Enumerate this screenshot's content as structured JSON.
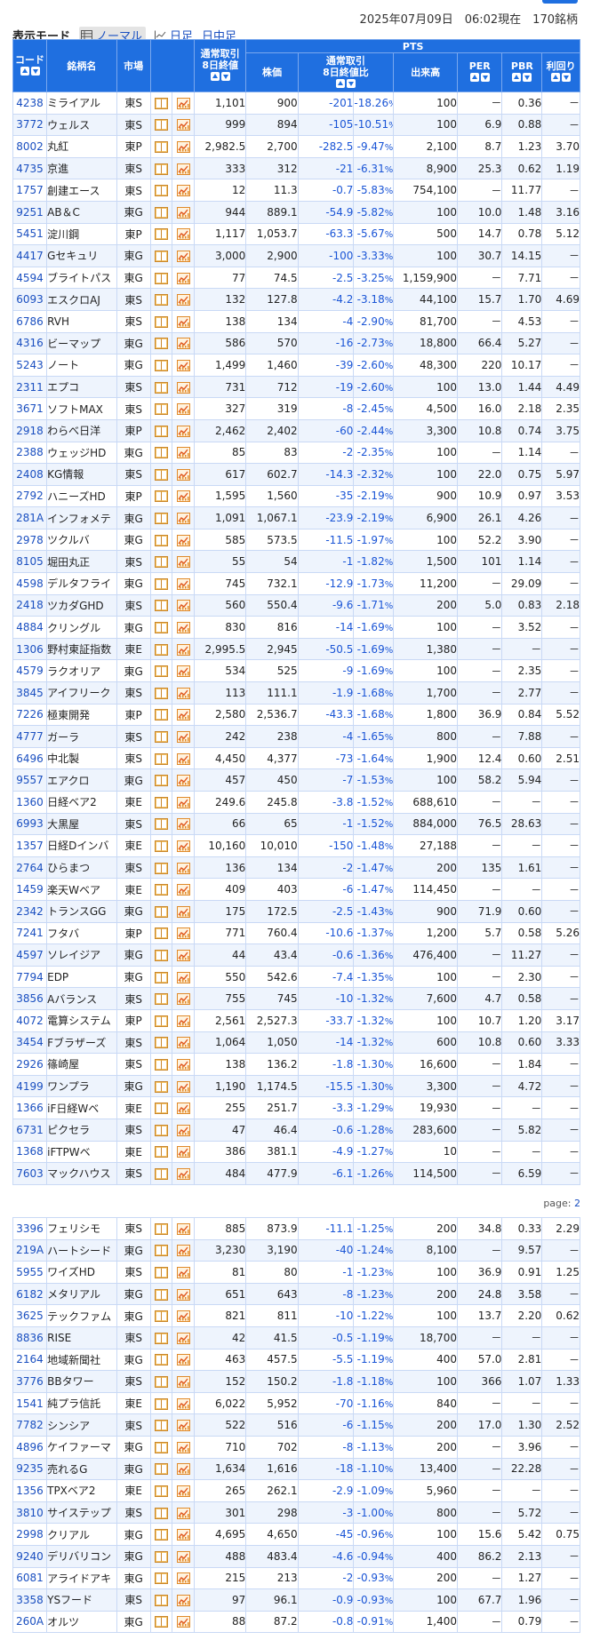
{
  "header": {
    "datetime": "2025年07月09日　06:02現在　170銘柄",
    "mode_label": "表示モード",
    "modes": [
      "ノーマル",
      "日足",
      "日中足"
    ]
  },
  "columns": {
    "code": "コード",
    "name": "銘柄名",
    "market": "市場",
    "prev_close": "通常取引\n8日終値",
    "pts_group": "PTS",
    "price": "株価",
    "change": "通常取引\n8日終値比",
    "volume": "出来高",
    "per": "PER",
    "pbr": "PBR",
    "yield": "利回り"
  },
  "pager": {
    "label": "page: ",
    "link": "2"
  },
  "rows1": [
    [
      "4238",
      "ミライアル",
      "東S",
      "1,101",
      "900",
      "-201",
      "-18.26",
      "100",
      "－",
      "0.36",
      "－"
    ],
    [
      "3772",
      "ウェルス",
      "東S",
      "999",
      "894",
      "-105",
      "-10.51",
      "100",
      "6.9",
      "0.88",
      "－"
    ],
    [
      "8002",
      "丸紅",
      "東P",
      "2,982.5",
      "2,700",
      "-282.5",
      "-9.47",
      "2,100",
      "8.7",
      "1.23",
      "3.70"
    ],
    [
      "4735",
      "京進",
      "東S",
      "333",
      "312",
      "-21",
      "-6.31",
      "8,900",
      "25.3",
      "0.62",
      "1.19"
    ],
    [
      "1757",
      "創建エース",
      "東S",
      "12",
      "11.3",
      "-0.7",
      "-5.83",
      "754,100",
      "－",
      "11.77",
      "－"
    ],
    [
      "9251",
      "AB＆C",
      "東G",
      "944",
      "889.1",
      "-54.9",
      "-5.82",
      "100",
      "10.0",
      "1.48",
      "3.16"
    ],
    [
      "5451",
      "淀川鋼",
      "東P",
      "1,117",
      "1,053.7",
      "-63.3",
      "-5.67",
      "500",
      "14.7",
      "0.78",
      "5.12"
    ],
    [
      "4417",
      "Gセキュリ",
      "東G",
      "3,000",
      "2,900",
      "-100",
      "-3.33",
      "100",
      "30.7",
      "14.15",
      "－"
    ],
    [
      "4594",
      "ブライトパス",
      "東G",
      "77",
      "74.5",
      "-2.5",
      "-3.25",
      "1,159,900",
      "－",
      "7.71",
      "－"
    ],
    [
      "6093",
      "エスクロAJ",
      "東S",
      "132",
      "127.8",
      "-4.2",
      "-3.18",
      "44,100",
      "15.7",
      "1.70",
      "4.69"
    ],
    [
      "6786",
      "RVH",
      "東S",
      "138",
      "134",
      "-4",
      "-2.90",
      "81,700",
      "－",
      "4.53",
      "－"
    ],
    [
      "4316",
      "ビーマップ",
      "東G",
      "586",
      "570",
      "-16",
      "-2.73",
      "18,800",
      "66.4",
      "5.27",
      "－"
    ],
    [
      "5243",
      "ノート",
      "東G",
      "1,499",
      "1,460",
      "-39",
      "-2.60",
      "48,300",
      "220",
      "10.17",
      "－"
    ],
    [
      "2311",
      "エプコ",
      "東S",
      "731",
      "712",
      "-19",
      "-2.60",
      "100",
      "13.0",
      "1.44",
      "4.49"
    ],
    [
      "3671",
      "ソフトMAX",
      "東S",
      "327",
      "319",
      "-8",
      "-2.45",
      "4,500",
      "16.0",
      "2.18",
      "2.35"
    ],
    [
      "2918",
      "わらべ日洋",
      "東P",
      "2,462",
      "2,402",
      "-60",
      "-2.44",
      "3,300",
      "10.8",
      "0.74",
      "3.75"
    ],
    [
      "2388",
      "ウェッジHD",
      "東G",
      "85",
      "83",
      "-2",
      "-2.35",
      "100",
      "－",
      "1.14",
      "－"
    ],
    [
      "2408",
      "KG情報",
      "東S",
      "617",
      "602.7",
      "-14.3",
      "-2.32",
      "100",
      "22.0",
      "0.75",
      "5.97"
    ],
    [
      "2792",
      "ハニーズHD",
      "東P",
      "1,595",
      "1,560",
      "-35",
      "-2.19",
      "900",
      "10.9",
      "0.97",
      "3.53"
    ],
    [
      "281A",
      "インフォメテ",
      "東G",
      "1,091",
      "1,067.1",
      "-23.9",
      "-2.19",
      "6,900",
      "26.1",
      "4.26",
      "－"
    ],
    [
      "2978",
      "ツクルバ",
      "東G",
      "585",
      "573.5",
      "-11.5",
      "-1.97",
      "100",
      "52.2",
      "3.90",
      "－"
    ],
    [
      "8105",
      "堀田丸正",
      "東S",
      "55",
      "54",
      "-1",
      "-1.82",
      "1,500",
      "101",
      "1.14",
      "－"
    ],
    [
      "4598",
      "デルタフライ",
      "東G",
      "745",
      "732.1",
      "-12.9",
      "-1.73",
      "11,200",
      "－",
      "29.09",
      "－"
    ],
    [
      "2418",
      "ツカダGHD",
      "東S",
      "560",
      "550.4",
      "-9.6",
      "-1.71",
      "200",
      "5.0",
      "0.83",
      "2.18"
    ],
    [
      "4884",
      "クリングル",
      "東G",
      "830",
      "816",
      "-14",
      "-1.69",
      "100",
      "－",
      "3.52",
      "－"
    ],
    [
      "1306",
      "野村東証指数",
      "東E",
      "2,995.5",
      "2,945",
      "-50.5",
      "-1.69",
      "1,380",
      "－",
      "－",
      "－"
    ],
    [
      "4579",
      "ラクオリア",
      "東G",
      "534",
      "525",
      "-9",
      "-1.69",
      "100",
      "－",
      "2.35",
      "－"
    ],
    [
      "3845",
      "アイフリーク",
      "東S",
      "113",
      "111.1",
      "-1.9",
      "-1.68",
      "1,700",
      "－",
      "2.77",
      "－"
    ],
    [
      "7226",
      "極東開発",
      "東P",
      "2,580",
      "2,536.7",
      "-43.3",
      "-1.68",
      "1,800",
      "36.9",
      "0.84",
      "5.52"
    ],
    [
      "4777",
      "ガーラ",
      "東S",
      "242",
      "238",
      "-4",
      "-1.65",
      "800",
      "－",
      "7.88",
      "－"
    ],
    [
      "6496",
      "中北製",
      "東S",
      "4,450",
      "4,377",
      "-73",
      "-1.64",
      "1,900",
      "12.4",
      "0.60",
      "2.51"
    ],
    [
      "9557",
      "エアクロ",
      "東G",
      "457",
      "450",
      "-7",
      "-1.53",
      "100",
      "58.2",
      "5.94",
      "－"
    ],
    [
      "1360",
      "日経ベア2",
      "東E",
      "249.6",
      "245.8",
      "-3.8",
      "-1.52",
      "688,610",
      "－",
      "－",
      "－"
    ],
    [
      "6993",
      "大黒屋",
      "東S",
      "66",
      "65",
      "-1",
      "-1.52",
      "884,000",
      "76.5",
      "28.63",
      "－"
    ],
    [
      "1357",
      "日経Dインバ",
      "東E",
      "10,160",
      "10,010",
      "-150",
      "-1.48",
      "27,188",
      "－",
      "－",
      "－"
    ],
    [
      "2764",
      "ひらまつ",
      "東S",
      "136",
      "134",
      "-2",
      "-1.47",
      "200",
      "135",
      "1.61",
      "－"
    ],
    [
      "1459",
      "楽天Wベア",
      "東E",
      "409",
      "403",
      "-6",
      "-1.47",
      "114,450",
      "－",
      "－",
      "－"
    ],
    [
      "2342",
      "トランスGG",
      "東G",
      "175",
      "172.5",
      "-2.5",
      "-1.43",
      "900",
      "71.9",
      "0.60",
      "－"
    ],
    [
      "7241",
      "フタバ",
      "東P",
      "771",
      "760.4",
      "-10.6",
      "-1.37",
      "1,200",
      "5.7",
      "0.58",
      "5.26"
    ],
    [
      "4597",
      "ソレイジア",
      "東G",
      "44",
      "43.4",
      "-0.6",
      "-1.36",
      "476,400",
      "－",
      "11.27",
      "－"
    ],
    [
      "7794",
      "EDP",
      "東G",
      "550",
      "542.6",
      "-7.4",
      "-1.35",
      "100",
      "－",
      "2.30",
      "－"
    ],
    [
      "3856",
      "Aバランス",
      "東S",
      "755",
      "745",
      "-10",
      "-1.32",
      "7,600",
      "4.7",
      "0.58",
      "－"
    ],
    [
      "4072",
      "電算システム",
      "東P",
      "2,561",
      "2,527.3",
      "-33.7",
      "-1.32",
      "100",
      "10.7",
      "1.20",
      "3.17"
    ],
    [
      "3454",
      "Fブラザーズ",
      "東S",
      "1,064",
      "1,050",
      "-14",
      "-1.32",
      "600",
      "10.8",
      "0.60",
      "3.33"
    ],
    [
      "2926",
      "篠崎屋",
      "東S",
      "138",
      "136.2",
      "-1.8",
      "-1.30",
      "16,600",
      "－",
      "1.84",
      "－"
    ],
    [
      "4199",
      "ワンプラ",
      "東G",
      "1,190",
      "1,174.5",
      "-15.5",
      "-1.30",
      "3,300",
      "－",
      "4.72",
      "－"
    ],
    [
      "1366",
      "iF日経Wベ",
      "東E",
      "255",
      "251.7",
      "-3.3",
      "-1.29",
      "19,930",
      "－",
      "－",
      "－"
    ],
    [
      "6731",
      "ピクセラ",
      "東S",
      "47",
      "46.4",
      "-0.6",
      "-1.28",
      "283,600",
      "－",
      "5.82",
      "－"
    ],
    [
      "1368",
      "iFTPWベ",
      "東E",
      "386",
      "381.1",
      "-4.9",
      "-1.27",
      "10",
      "－",
      "－",
      "－"
    ],
    [
      "7603",
      "マックハウス",
      "東S",
      "484",
      "477.9",
      "-6.1",
      "-1.26",
      "114,500",
      "－",
      "6.59",
      "－"
    ]
  ],
  "rows2": [
    [
      "3396",
      "フェリシモ",
      "東S",
      "885",
      "873.9",
      "-11.1",
      "-1.25",
      "200",
      "34.8",
      "0.33",
      "2.29"
    ],
    [
      "219A",
      "ハートシード",
      "東G",
      "3,230",
      "3,190",
      "-40",
      "-1.24",
      "8,100",
      "－",
      "9.57",
      "－"
    ],
    [
      "5955",
      "ワイズHD",
      "東S",
      "81",
      "80",
      "-1",
      "-1.23",
      "100",
      "36.9",
      "0.91",
      "1.25"
    ],
    [
      "6182",
      "メタリアル",
      "東G",
      "651",
      "643",
      "-8",
      "-1.23",
      "200",
      "24.8",
      "3.58",
      "－"
    ],
    [
      "3625",
      "テックファム",
      "東G",
      "821",
      "811",
      "-10",
      "-1.22",
      "100",
      "13.7",
      "2.20",
      "0.62"
    ],
    [
      "8836",
      "RISE",
      "東S",
      "42",
      "41.5",
      "-0.5",
      "-1.19",
      "18,700",
      "－",
      "－",
      "－"
    ],
    [
      "2164",
      "地域新聞社",
      "東G",
      "463",
      "457.5",
      "-5.5",
      "-1.19",
      "400",
      "57.0",
      "2.81",
      "－"
    ],
    [
      "3776",
      "BBタワー",
      "東S",
      "152",
      "150.2",
      "-1.8",
      "-1.18",
      "100",
      "366",
      "1.07",
      "1.33"
    ],
    [
      "1541",
      "純プラ信託",
      "東E",
      "6,022",
      "5,952",
      "-70",
      "-1.16",
      "840",
      "－",
      "－",
      "－"
    ],
    [
      "7782",
      "シンシア",
      "東S",
      "522",
      "516",
      "-6",
      "-1.15",
      "200",
      "17.0",
      "1.30",
      "2.52"
    ],
    [
      "4896",
      "ケイファーマ",
      "東G",
      "710",
      "702",
      "-8",
      "-1.13",
      "200",
      "－",
      "3.96",
      "－"
    ],
    [
      "9235",
      "売れるG",
      "東G",
      "1,634",
      "1,616",
      "-18",
      "-1.10",
      "13,400",
      "－",
      "22.28",
      "－"
    ],
    [
      "1356",
      "TPXベア2",
      "東E",
      "265",
      "262.1",
      "-2.9",
      "-1.09",
      "5,960",
      "－",
      "－",
      "－"
    ],
    [
      "3810",
      "サイステップ",
      "東S",
      "301",
      "298",
      "-3",
      "-1.00",
      "800",
      "－",
      "5.72",
      "－"
    ],
    [
      "2998",
      "クリアル",
      "東G",
      "4,695",
      "4,650",
      "-45",
      "-0.96",
      "100",
      "15.6",
      "5.42",
      "0.75"
    ],
    [
      "9240",
      "デリバリコン",
      "東G",
      "488",
      "483.4",
      "-4.6",
      "-0.94",
      "400",
      "86.2",
      "2.13",
      "－"
    ],
    [
      "6081",
      "アライドアキ",
      "東G",
      "215",
      "213",
      "-2",
      "-0.93",
      "200",
      "－",
      "1.27",
      "－"
    ],
    [
      "3358",
      "YSフード",
      "東S",
      "97",
      "96.1",
      "-0.9",
      "-0.93",
      "100",
      "67.7",
      "1.96",
      "－"
    ],
    [
      "260A",
      "オルツ",
      "東G",
      "88",
      "87.2",
      "-0.8",
      "-0.91",
      "1,400",
      "－",
      "0.79",
      "－"
    ]
  ]
}
